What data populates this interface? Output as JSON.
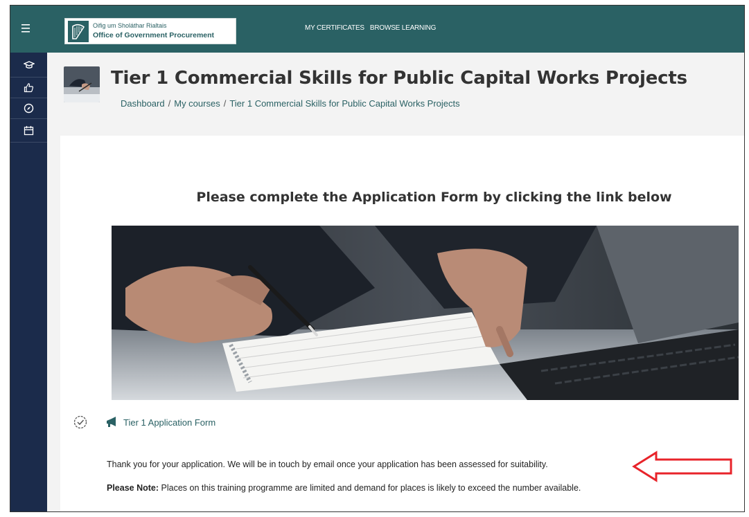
{
  "topbar": {
    "menu_icon": "hamburger-icon",
    "logo": {
      "line1": "Oifig um Sholáthar Rialtais",
      "line2": "Office of Government Procurement"
    },
    "nav": [
      {
        "label": "MY CERTIFICATES"
      },
      {
        "label": "BROWSE LEARNING"
      }
    ],
    "color": "#2a6164"
  },
  "sidebar": {
    "color": "#1b2b4b",
    "items": [
      {
        "icon": "graduation-cap-icon"
      },
      {
        "icon": "thumbs-up-icon"
      },
      {
        "icon": "compass-icon"
      },
      {
        "icon": "calendar-icon"
      }
    ]
  },
  "header": {
    "title": "Tier 1 Commercial Skills for Public Capital Works Projects",
    "breadcrumb": [
      {
        "label": "Dashboard"
      },
      {
        "label": "My courses"
      },
      {
        "label": "Tier 1 Commercial Skills for Public Capital Works Projects"
      }
    ],
    "breadcrumb_separator": "/"
  },
  "main": {
    "heading": "Please complete the Application Form by clicking the link below",
    "activity": {
      "completion_icon": "check-circle-icon",
      "type_icon": "megaphone-icon",
      "label": "Tier 1 Application Form"
    },
    "thanks_text": "Thank you for your application. We will be in touch by email once your application has been assessed for suitability.",
    "note_label": "Please Note:",
    "note_text": " Places on this training programme are limited and demand for places is likely to exceed the number available.",
    "annotation_arrow_color": "#e8232a"
  }
}
